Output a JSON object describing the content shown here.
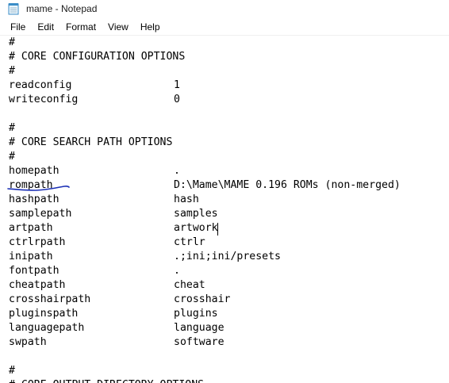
{
  "window": {
    "title": "mame - Notepad"
  },
  "menu": [
    "File",
    "Edit",
    "Format",
    "View",
    "Help"
  ],
  "lines": [
    {
      "key": "#",
      "val": ""
    },
    {
      "key": "# CORE CONFIGURATION OPTIONS",
      "val": ""
    },
    {
      "key": "#",
      "val": ""
    },
    {
      "key": "readconfig",
      "val": "1"
    },
    {
      "key": "writeconfig",
      "val": "0"
    },
    {
      "key": "",
      "val": ""
    },
    {
      "key": "#",
      "val": ""
    },
    {
      "key": "# CORE SEARCH PATH OPTIONS",
      "val": ""
    },
    {
      "key": "#",
      "val": ""
    },
    {
      "key": "homepath",
      "val": "."
    },
    {
      "key": "rompath",
      "val": "D:\\Mame\\MAME 0.196 ROMs (non-merged)"
    },
    {
      "key": "hashpath",
      "val": "hash"
    },
    {
      "key": "samplepath",
      "val": "samples"
    },
    {
      "key": "artpath",
      "val": "artwork"
    },
    {
      "key": "ctrlrpath",
      "val": "ctrlr"
    },
    {
      "key": "inipath",
      "val": ".;ini;ini/presets"
    },
    {
      "key": "fontpath",
      "val": "."
    },
    {
      "key": "cheatpath",
      "val": "cheat"
    },
    {
      "key": "crosshairpath",
      "val": "crosshair"
    },
    {
      "key": "pluginspath",
      "val": "plugins"
    },
    {
      "key": "languagepath",
      "val": "language"
    },
    {
      "key": "swpath",
      "val": "software"
    },
    {
      "key": "",
      "val": ""
    },
    {
      "key": "#",
      "val": ""
    },
    {
      "key": "# CORE OUTPUT DIRECTORY OPTIONS",
      "val": ""
    }
  ],
  "colors": {
    "annotation": "#1a2fb5"
  },
  "icons": {
    "app": "notepad-icon"
  }
}
